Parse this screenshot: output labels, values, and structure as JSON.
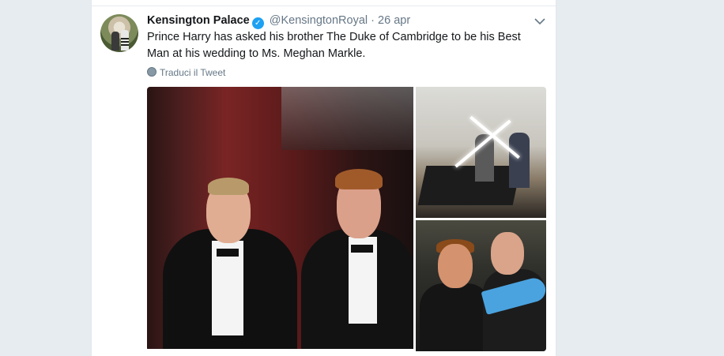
{
  "tweet": {
    "author_name": "Kensington Palace",
    "verified_mark": "✓",
    "handle": "@KensingtonRoyal",
    "separator": "·",
    "date": "26 apr",
    "text": "Prince Harry has asked his brother The Duke of Cambridge to be his Best Man at his wedding to Ms. Meghan Markle.",
    "translate_label": "Traduci il Tweet",
    "menu_icon": "chevron-down-icon"
  },
  "colors": {
    "background": "#e6ecf0",
    "card": "#ffffff",
    "text_primary": "#14171a",
    "text_secondary": "#657786",
    "verified": "#1da1f2"
  },
  "media": {
    "count": 3
  }
}
